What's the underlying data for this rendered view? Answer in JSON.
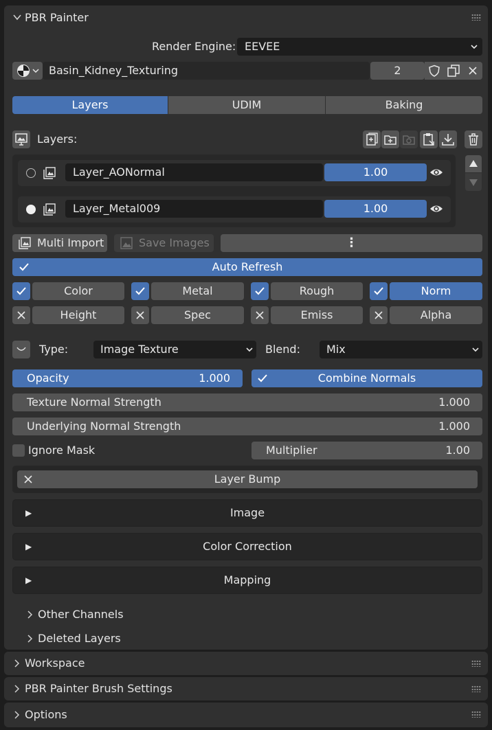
{
  "panel": {
    "title": "PBR Painter"
  },
  "render": {
    "label": "Render Engine:",
    "value": "EEVEE"
  },
  "material": {
    "name": "Basin_Kidney_Texturing",
    "users": "2"
  },
  "tabs": [
    {
      "label": "Layers"
    },
    {
      "label": "UDIM"
    },
    {
      "label": "Baking"
    }
  ],
  "layers": {
    "label": "Layers:",
    "items": [
      {
        "name": "Layer_AONormal",
        "value": "1.00"
      },
      {
        "name": "Layer_Metal009",
        "value": "1.00"
      }
    ]
  },
  "actions": {
    "multi_import": "Multi Import",
    "save_images": "Save Images",
    "more": "⋮"
  },
  "auto_refresh": "Auto Refresh",
  "channels_row1": [
    {
      "label": "Color"
    },
    {
      "label": "Metal"
    },
    {
      "label": "Rough"
    },
    {
      "label": "Norm"
    }
  ],
  "channels_row2": [
    {
      "label": "Height"
    },
    {
      "label": "Spec"
    },
    {
      "label": "Emiss"
    },
    {
      "label": "Alpha"
    }
  ],
  "type": {
    "label": "Type:",
    "value": "Image Texture"
  },
  "blend": {
    "label": "Blend:",
    "value": "Mix"
  },
  "opacity": {
    "label": "Opacity",
    "value": "1.000"
  },
  "combine_normals": "Combine Normals",
  "texture_normal": {
    "label": "Texture Normal Strength",
    "value": "1.000"
  },
  "underlying_normal": {
    "label": "Underlying Normal Strength",
    "value": "1.000"
  },
  "ignore_mask": "Ignore Mask",
  "multiplier": {
    "label": "Multiplier",
    "value": "1.00"
  },
  "layer_bump": "Layer Bump",
  "subpanels": [
    {
      "label": "Image"
    },
    {
      "label": "Color Correction"
    },
    {
      "label": "Mapping"
    }
  ],
  "collapsed": [
    {
      "label": "Other Channels"
    },
    {
      "label": "Deleted Layers"
    }
  ],
  "bottom_panels": [
    {
      "label": "Workspace"
    },
    {
      "label": "PBR Painter Brush Settings"
    },
    {
      "label": "Options"
    }
  ],
  "colors": {
    "accent": "#4772b3",
    "panel": "#303030",
    "field": "#1d1d1d",
    "button": "#545454"
  }
}
